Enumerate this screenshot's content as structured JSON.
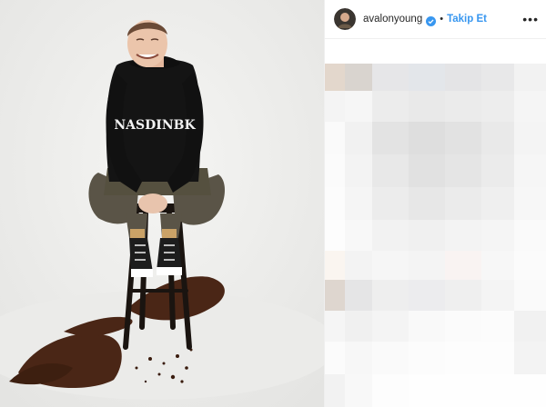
{
  "header": {
    "username": "avalonyoung",
    "verified_icon": "verified-badge-icon",
    "separator": "•",
    "follow_label": "Takip Et",
    "more_icon": "more-options-icon",
    "more_glyph": "•••"
  },
  "colors": {
    "follow_blue": "#3897f0",
    "verified_blue": "#3897f0",
    "text_dark": "#262626",
    "photo_bg": "#f0f0ee"
  },
  "photo": {
    "hoodie_text": "NASDINBK"
  }
}
